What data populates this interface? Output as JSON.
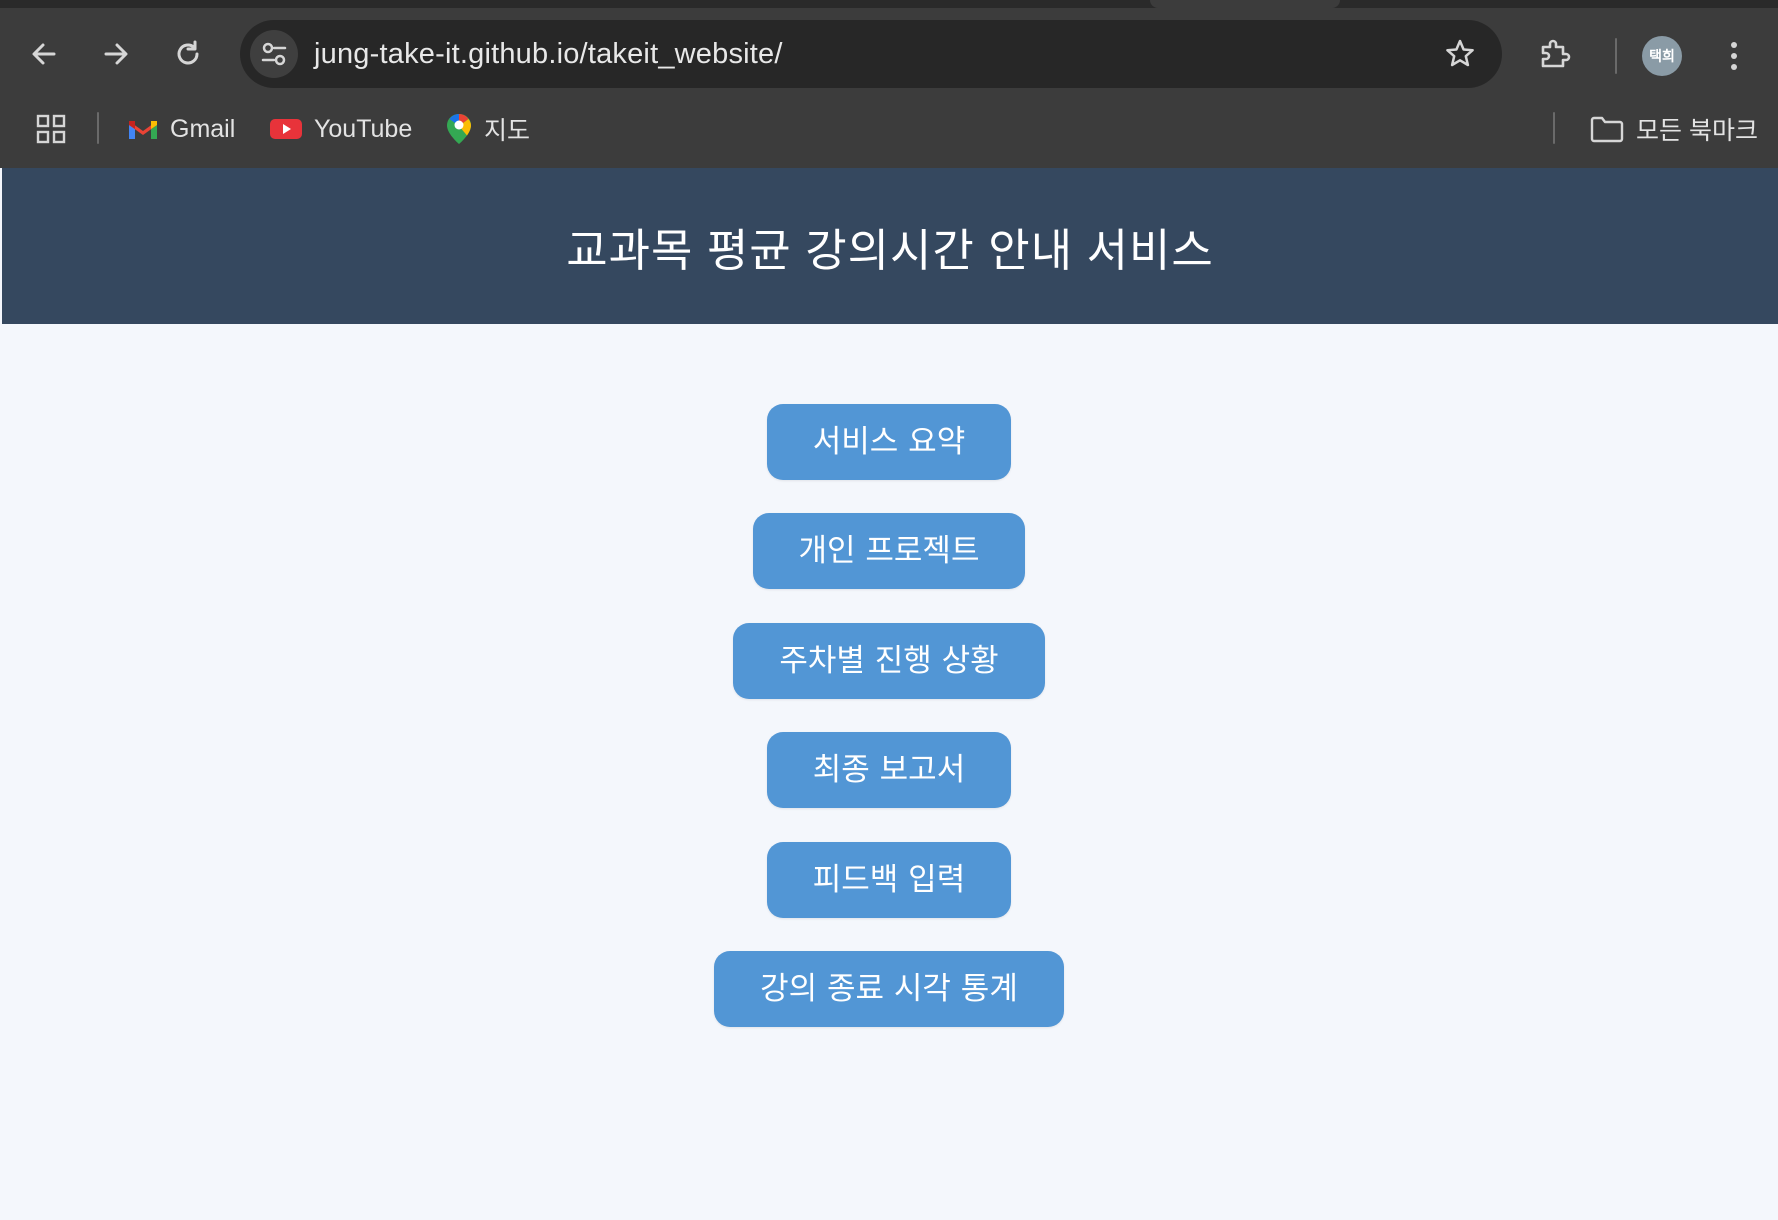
{
  "browser": {
    "url": "jung-take-it.github.io/takeit_website/",
    "profile_initials": "택희",
    "bookmarks": [
      {
        "label": "Gmail",
        "icon": "gmail-icon"
      },
      {
        "label": "YouTube",
        "icon": "youtube-icon"
      },
      {
        "label": "지도",
        "icon": "maps-icon"
      }
    ],
    "all_bookmarks_label": "모든 북마크"
  },
  "page": {
    "title": "교과목 평균 강의시간 안내 서비스",
    "buttons": [
      {
        "label": "서비스 요약"
      },
      {
        "label": "개인 프로젝트"
      },
      {
        "label": "주차별 진행 상황"
      },
      {
        "label": "최종 보고서"
      },
      {
        "label": "피드백 입력"
      },
      {
        "label": "강의 종료 시각 통계"
      }
    ]
  },
  "colors": {
    "header_bg": "#35485f",
    "button_bg": "#5296d5",
    "page_bg": "#f4f7fc",
    "chrome_bg": "#3c3c3c"
  }
}
